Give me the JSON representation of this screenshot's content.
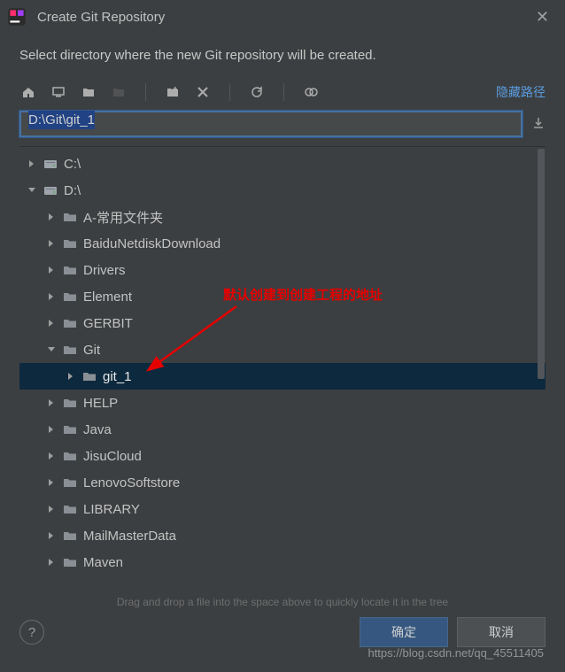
{
  "titlebar": {
    "title": "Create Git Repository"
  },
  "subtitle": "Select directory where the new Git repository will be created.",
  "toolbar": {
    "hide_path": "隐藏路径"
  },
  "path_input": "D:\\Git\\git_1",
  "annotation": "默认创建到创建工程的地址",
  "tree": [
    {
      "label": "C:\\",
      "depth": 1,
      "expanded": false,
      "kind": "disk",
      "selected": false
    },
    {
      "label": "D:\\",
      "depth": 1,
      "expanded": true,
      "kind": "disk",
      "selected": false
    },
    {
      "label": "A-常用文件夹",
      "depth": 2,
      "expanded": false,
      "kind": "folder",
      "selected": false
    },
    {
      "label": "BaiduNetdiskDownload",
      "depth": 2,
      "expanded": false,
      "kind": "folder",
      "selected": false
    },
    {
      "label": "Drivers",
      "depth": 2,
      "expanded": false,
      "kind": "folder",
      "selected": false
    },
    {
      "label": "Element",
      "depth": 2,
      "expanded": false,
      "kind": "folder",
      "selected": false
    },
    {
      "label": "GERBIT",
      "depth": 2,
      "expanded": false,
      "kind": "folder",
      "selected": false
    },
    {
      "label": "Git",
      "depth": 2,
      "expanded": true,
      "kind": "folder",
      "selected": false
    },
    {
      "label": "git_1",
      "depth": 3,
      "expanded": false,
      "kind": "folder",
      "selected": true
    },
    {
      "label": "HELP",
      "depth": 2,
      "expanded": false,
      "kind": "folder",
      "selected": false
    },
    {
      "label": "Java",
      "depth": 2,
      "expanded": false,
      "kind": "folder",
      "selected": false
    },
    {
      "label": "JisuCloud",
      "depth": 2,
      "expanded": false,
      "kind": "folder",
      "selected": false
    },
    {
      "label": "LenovoSoftstore",
      "depth": 2,
      "expanded": false,
      "kind": "folder",
      "selected": false
    },
    {
      "label": "LIBRARY",
      "depth": 2,
      "expanded": false,
      "kind": "folder",
      "selected": false
    },
    {
      "label": "MailMasterData",
      "depth": 2,
      "expanded": false,
      "kind": "folder",
      "selected": false
    },
    {
      "label": "Maven",
      "depth": 2,
      "expanded": false,
      "kind": "folder",
      "selected": false
    }
  ],
  "hint": "Drag and drop a file into the space above to quickly locate it in the tree",
  "footer": {
    "ok": "确定",
    "cancel": "取消"
  },
  "watermark": "https://blog.csdn.net/qq_45511405"
}
